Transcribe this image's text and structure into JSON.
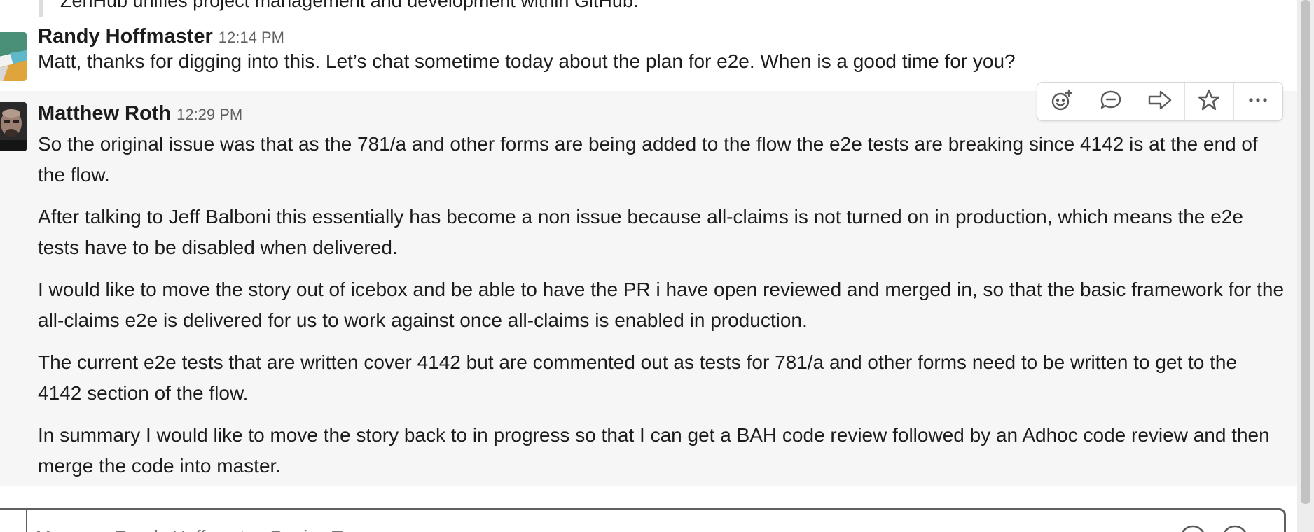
{
  "quoted": {
    "text": "ZenHub unifies project management and development within GitHub."
  },
  "messages": [
    {
      "author": "Randy Hoffmaster",
      "time": "12:14 PM",
      "paragraphs": [
        "Matt, thanks for digging into this.  Let’s chat sometime today about the plan for e2e.  When is a good time for you?"
      ]
    },
    {
      "author": "Matthew Roth",
      "time": "12:29 PM",
      "paragraphs": [
        "So the original issue was that as the 781/a and other forms are being added to the flow the e2e tests are breaking since 4142 is at the end of the flow.",
        "After talking to Jeff Balboni this essentially has become a non issue because all-claims is not turned on in production, which means the e2e tests have to be disabled when delivered.",
        "I would like to move the story out of icebox and be able to have the PR i have open reviewed and merged in, so that the basic framework for the all-claims e2e is delivered for us to work against once all-claims is enabled in production.",
        "The current e2e tests that are written cover 4142 but are commented out as tests for 781/a and other forms need to be written to get to the 4142 section of the flow.",
        "In summary I would like to move the story back to in progress so that I can get a BAH code review followed by an Adhoc code review and then merge the code into master."
      ]
    }
  ],
  "message_actions": [
    {
      "icon": "add-reaction-icon"
    },
    {
      "icon": "reply-in-thread-icon"
    },
    {
      "icon": "share-message-icon"
    },
    {
      "icon": "star-icon"
    },
    {
      "icon": "more-actions-icon"
    }
  ],
  "composer": {
    "placeholder": "Message Randy Hoffmaster, Denise Tran"
  },
  "colors": {
    "hover_bg": "#f6f6f6",
    "text": "#1d1c1d",
    "muted": "#616061"
  }
}
